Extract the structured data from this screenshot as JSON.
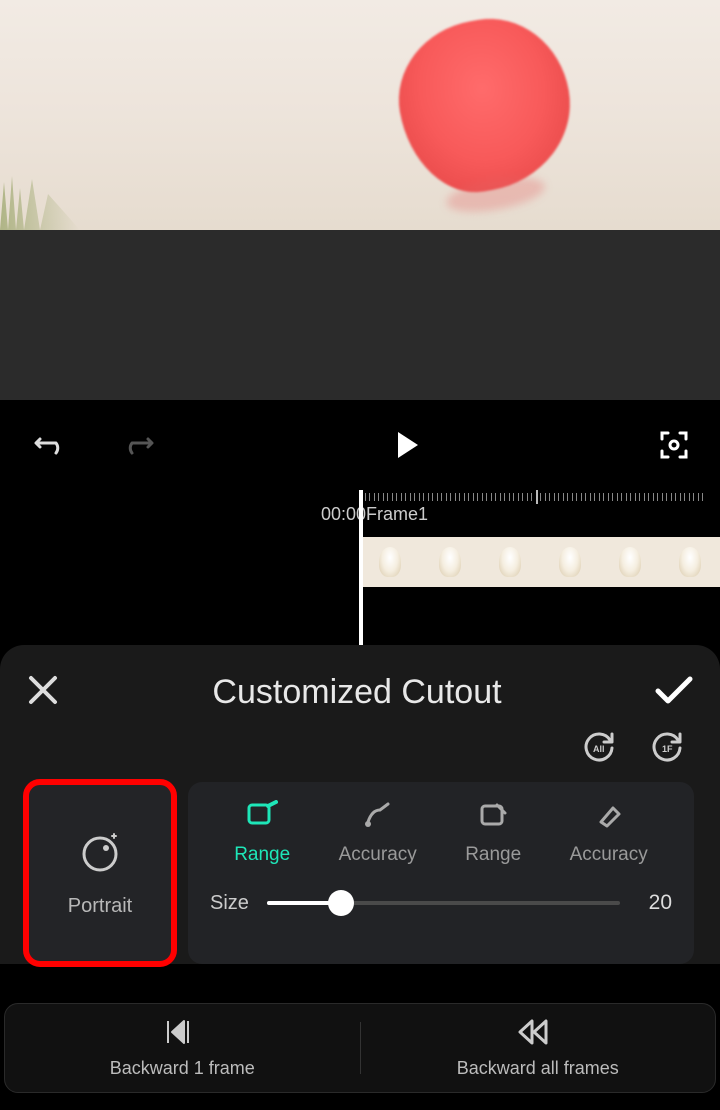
{
  "preview": {},
  "timeline": {
    "time": "00:00",
    "frame": "Frame1"
  },
  "panel": {
    "title": "Customized Cutout",
    "reset_all_icon": "reset-all",
    "reset_frame_icon": "reset-1f",
    "portrait": {
      "label": "Portrait"
    },
    "brush": {
      "tabs": [
        {
          "label": "Range",
          "active": true
        },
        {
          "label": "Accuracy",
          "active": false
        },
        {
          "label": "Range",
          "active": false
        },
        {
          "label": "Accuracy",
          "active": false
        }
      ],
      "size_label": "Size",
      "size_value": "20"
    }
  },
  "bottom": {
    "backward1": "Backward 1 frame",
    "backwardAll": "Backward all frames"
  }
}
